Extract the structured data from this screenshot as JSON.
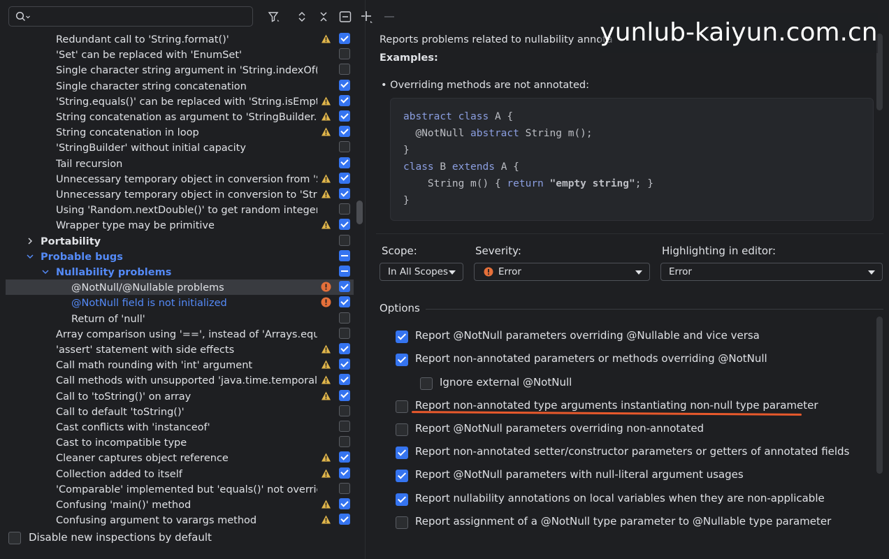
{
  "search": {
    "value": "",
    "placeholder": ""
  },
  "toolbar": {
    "icons": [
      "filter-icon",
      "expand-all-icon",
      "collapse-all-icon",
      "collapse-icon",
      "add-icon",
      "remove-icon"
    ]
  },
  "tree": {
    "rows": [
      {
        "label": "Redundant call to 'String.format()'",
        "level": 2,
        "marker": "warn",
        "check": "on"
      },
      {
        "label": "'Set' can be replaced with 'EnumSet'",
        "level": 2,
        "marker": "",
        "check": "off"
      },
      {
        "label": "Single character string argument in 'String.indexOf()'",
        "level": 2,
        "marker": "",
        "check": "off"
      },
      {
        "label": "Single character string concatenation",
        "level": 2,
        "marker": "",
        "check": "on"
      },
      {
        "label": "'String.equals()' can be replaced with 'String.isEmpty",
        "level": 2,
        "marker": "warn",
        "check": "on"
      },
      {
        "label": "String concatenation as argument to 'StringBuilder.a",
        "level": 2,
        "marker": "warn",
        "check": "on"
      },
      {
        "label": "String concatenation in loop",
        "level": 2,
        "marker": "warn",
        "check": "on"
      },
      {
        "label": "'StringBuilder' without initial capacity",
        "level": 2,
        "marker": "",
        "check": "off"
      },
      {
        "label": "Tail recursion",
        "level": 2,
        "marker": "",
        "check": "on"
      },
      {
        "label": "Unnecessary temporary object in conversion from 'S",
        "level": 2,
        "marker": "warn",
        "check": "on"
      },
      {
        "label": "Unnecessary temporary object in conversion to 'Strir",
        "level": 2,
        "marker": "warn",
        "check": "on"
      },
      {
        "label": "Using 'Random.nextDouble()' to get random integer",
        "level": 2,
        "marker": "",
        "check": "off"
      },
      {
        "label": "Wrapper type may be primitive",
        "level": 2,
        "marker": "warn",
        "check": "on"
      },
      {
        "label": "Portability",
        "level": 1,
        "marker": "",
        "check": "off",
        "chevron": "right",
        "group": true
      },
      {
        "label": "Probable bugs",
        "level": 1,
        "marker": "",
        "check": "mixed",
        "chevron": "down",
        "group": true,
        "blue": true
      },
      {
        "label": "Nullability problems",
        "level": 2,
        "marker": "",
        "check": "mixed",
        "chevron": "down",
        "group": true,
        "blue": true
      },
      {
        "label": "@NotNull/@Nullable problems",
        "level": 3,
        "marker": "err",
        "check": "on",
        "selected": true
      },
      {
        "label": "@NotNull field is not initialized",
        "level": 3,
        "marker": "err",
        "check": "on",
        "blue": true
      },
      {
        "label": "Return of 'null'",
        "level": 3,
        "marker": "",
        "check": "off"
      },
      {
        "label": "Array comparison using '==', instead of 'Arrays.equal",
        "level": 2,
        "marker": "",
        "check": "off"
      },
      {
        "label": "'assert' statement with side effects",
        "level": 2,
        "marker": "warn",
        "check": "on"
      },
      {
        "label": "Call math rounding with 'int' argument",
        "level": 2,
        "marker": "warn",
        "check": "on"
      },
      {
        "label": "Call methods with unsupported 'java.time.temporal.C",
        "level": 2,
        "marker": "warn",
        "check": "on"
      },
      {
        "label": "Call to 'toString()' on array",
        "level": 2,
        "marker": "warn",
        "check": "on"
      },
      {
        "label": "Call to default 'toString()'",
        "level": 2,
        "marker": "",
        "check": "off"
      },
      {
        "label": "Cast conflicts with 'instanceof'",
        "level": 2,
        "marker": "",
        "check": "off"
      },
      {
        "label": "Cast to incompatible type",
        "level": 2,
        "marker": "",
        "check": "off"
      },
      {
        "label": "Cleaner captures object reference",
        "level": 2,
        "marker": "warn",
        "check": "on"
      },
      {
        "label": "Collection added to itself",
        "level": 2,
        "marker": "warn",
        "check": "on"
      },
      {
        "label": "'Comparable' implemented but 'equals()' not overrido",
        "level": 2,
        "marker": "",
        "check": "off"
      },
      {
        "label": "Confusing 'main()' method",
        "level": 2,
        "marker": "warn",
        "check": "on"
      },
      {
        "label": "Confusing argument to varargs method",
        "level": 2,
        "marker": "warn",
        "check": "on"
      }
    ]
  },
  "footer": {
    "label": "Disable new inspections by default"
  },
  "description": {
    "line1": "Reports problems related to nullability annota",
    "examples_label": "Examples:",
    "bullet": "• Overriding methods are not annotated:",
    "code": [
      [
        {
          "t": "abstract class ",
          "k": 1
        },
        {
          "t": "A {",
          "k": 0
        }
      ],
      [
        {
          "t": "  @NotNull ",
          "k": 0
        },
        {
          "t": "abstract ",
          "k": 1
        },
        {
          "t": "String m();",
          "k": 0
        }
      ],
      [
        {
          "t": "}",
          "k": 0
        }
      ],
      [
        {
          "t": "class ",
          "k": 1
        },
        {
          "t": "B ",
          "k": 0
        },
        {
          "t": "extends ",
          "k": 1
        },
        {
          "t": "A {",
          "k": 0
        }
      ],
      [
        {
          "t": "    String m() { ",
          "k": 0
        },
        {
          "t": "return ",
          "k": 1
        },
        {
          "t": "\"empty string\"",
          "k": 2
        },
        {
          "t": "; }",
          "k": 0
        }
      ],
      [
        {
          "t": "}",
          "k": 0
        }
      ]
    ]
  },
  "scope": {
    "label": "Scope:",
    "value": "In All Scopes"
  },
  "severity": {
    "label": "Severity:",
    "value": "Error",
    "icon": "error-icon",
    "color": "#e5703a"
  },
  "highlighting": {
    "label": "Highlighting in editor:",
    "value": "Error"
  },
  "options": {
    "title": "Options",
    "items": [
      {
        "label": "Report @NotNull parameters overriding @Nullable and vice versa",
        "checked": true,
        "indent": false
      },
      {
        "label": "Report non-annotated parameters or methods overriding @NotNull",
        "checked": true,
        "indent": false
      },
      {
        "label": "Ignore external @NotNull",
        "checked": false,
        "indent": true
      },
      {
        "label": "Report non-annotated type arguments instantiating non-null type parameter",
        "checked": false,
        "indent": false,
        "highlighted": true
      },
      {
        "label": "Report @NotNull parameters overriding non-annotated",
        "checked": false,
        "indent": false
      },
      {
        "label": "Report non-annotated setter/constructor parameters or getters of annotated fields",
        "checked": true,
        "indent": false
      },
      {
        "label": "Report @NotNull parameters with null-literal argument usages",
        "checked": true,
        "indent": false
      },
      {
        "label": "Report nullability annotations on local variables when they are non-applicable",
        "checked": true,
        "indent": false
      },
      {
        "label": "Report assignment of a @NotNull type parameter to @Nullable type parameter",
        "checked": false,
        "indent": false
      }
    ]
  },
  "watermark": {
    "text": "yunlub-kaiyun.com.cn"
  },
  "colors": {
    "accent": "#3574f0",
    "link": "#548af7",
    "warning": "#e0b54a",
    "error": "#e5703a",
    "underline": "#e8592c"
  }
}
